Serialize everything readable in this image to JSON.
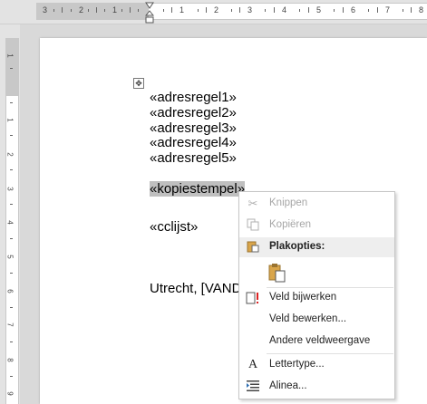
{
  "ruler": {
    "h_labels": [
      "3",
      "2",
      "1",
      "1",
      "2",
      "3",
      "4",
      "5",
      "6",
      "7",
      "8"
    ],
    "v_labels": [
      "1",
      "1",
      "2",
      "3",
      "4",
      "5",
      "6",
      "7",
      "8",
      "9"
    ]
  },
  "document": {
    "lines": [
      "«adresregel1»",
      "«adresregel2»",
      "«adresregel3»",
      "«adresregel4»",
      "«adresregel5»"
    ],
    "kopiestempel": "«kopiestempel»",
    "cclijst": "«cclijst»",
    "closing": "Utrecht, [VANDA"
  },
  "context_menu": {
    "knippen": "Knippen",
    "kopieren": "Kopiëren",
    "plakopties": "Plakopties:",
    "veld_bijwerken": "Veld bijwerken",
    "veld_bewerken": "Veld bewerken...",
    "andere_veldweergave": "Andere veldweergave",
    "lettertype": "Lettertype...",
    "alinea": "Alinea..."
  }
}
